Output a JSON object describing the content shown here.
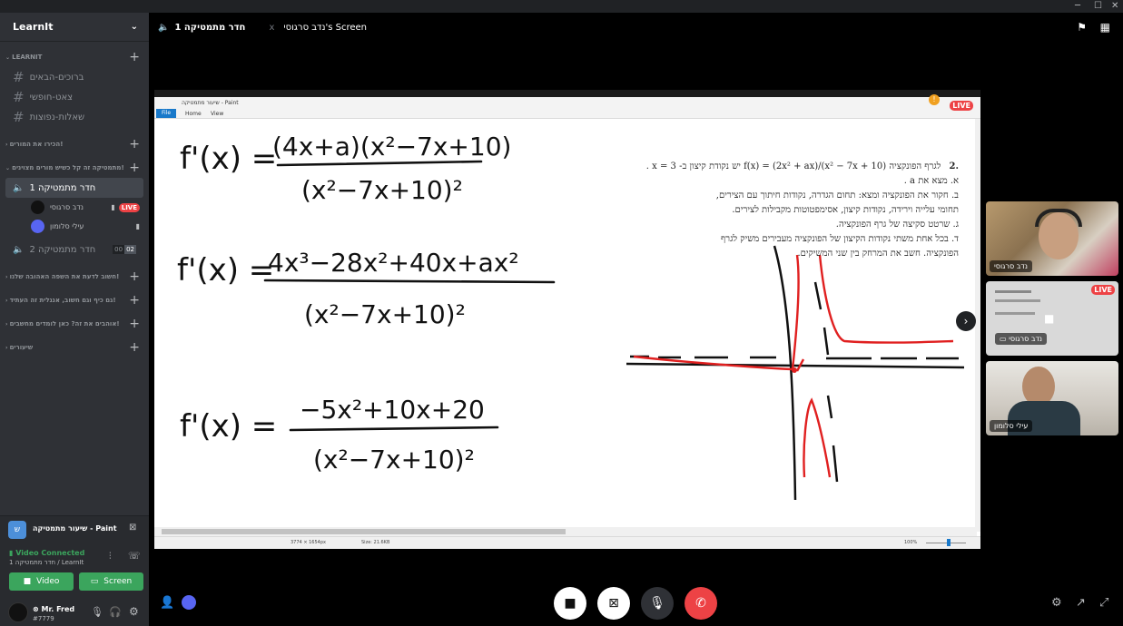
{
  "window": {
    "min": "─",
    "max": "☐",
    "close": "✕"
  },
  "server": {
    "name": "LearnIt"
  },
  "categories": [
    {
      "label": "LEARNIT"
    },
    {
      "label": "הכירו את המורים!"
    },
    {
      "label": "מתמטיקה זה קל כשיש מורים מצוינים!"
    },
    {
      "label": "חשוב לדעת את השפה האהובה שלנו!"
    },
    {
      "label": "גם כיף וגם חשוב, אנגלית זה העתיד!"
    },
    {
      "label": "אוהבים את זה? כאן לומדים מחשבים!"
    },
    {
      "label": "שיעורים"
    }
  ],
  "text_channels": [
    "ברוכים-הבאים",
    "צאט-חופשי",
    "שאלות-נפוצות"
  ],
  "voice_channels": {
    "room1": "חדר מתמטיקה 1",
    "room2": "חדר מתמטיקה 2",
    "room2_count_a": "00",
    "room2_count_b": "02"
  },
  "voice_users": [
    {
      "name": "נדב סרגוסי",
      "badge": "LIVE"
    },
    {
      "name": "עילי סלומון"
    }
  ],
  "activity": {
    "title": "שיעור מתמטיקה - Paint"
  },
  "voice_status": {
    "title": "Video Connected",
    "subtitle": "חדר מתמטיקה 1 / LearnIt"
  },
  "buttons": {
    "video": "Video",
    "screen": "Screen"
  },
  "user": {
    "name": "Mr. Fred",
    "tag": "#7779"
  },
  "topbar": {
    "channel": "חדר מתמטיקה 1",
    "screen_label": "נדב סרגוסי's Screen"
  },
  "stream": {
    "live": "LIVE",
    "paint_title": "שיעור מתמטיקה - Paint",
    "tab_file": "File",
    "tab_home": "Home",
    "tab_view": "View",
    "status_dims": "3774 × 1654px",
    "status_size": "Size: 21.6KB",
    "zoom": "100%"
  },
  "equations": {
    "eq1_lhs": "f'(x) =",
    "eq1_num": "(4x+a)(x²−7x+10)",
    "eq1_den": "(x²−7x+10)²",
    "eq2_lhs": "f'(x) =",
    "eq2_num": "4x³−28x²+40x+ax²",
    "eq2_den": "(x²−7x+10)²",
    "eq3_lhs": "f'(x) =",
    "eq3_num": "−5x²+10x+20",
    "eq3_den": "(x²−7x+10)²"
  },
  "problem": {
    "number": ".2",
    "line1": "לגרף הפונקציה f(x) = (2x² + ax)/(x² − 7x + 10) יש נקודת קיצון ב- x = 3 .",
    "line2": "א. מצא את a .",
    "line3": "ב. חקור את הפונקציה ומצא: תחום הגדרה, נקודות חיתוך עם הצירים,",
    "line4": "תחומי עלייה וירידה, נקודות קיצון, אסימפטוטות מקבילות לצירים.",
    "line5": "ג. שרטט סקיצה של גרף הפונקציה.",
    "line6": "ד. בכל אחת משתי נקודות הקיצון של הפונקציה מעבירים משיק לגרף",
    "line7": "הפונקציה. חשב את המרחק בין שני המשיקים."
  },
  "participants": [
    {
      "name": "נדב סרגוסי"
    },
    {
      "name": "נדב סרגוסי",
      "badge": "LIVE"
    },
    {
      "name": "עילי סלומון"
    }
  ]
}
